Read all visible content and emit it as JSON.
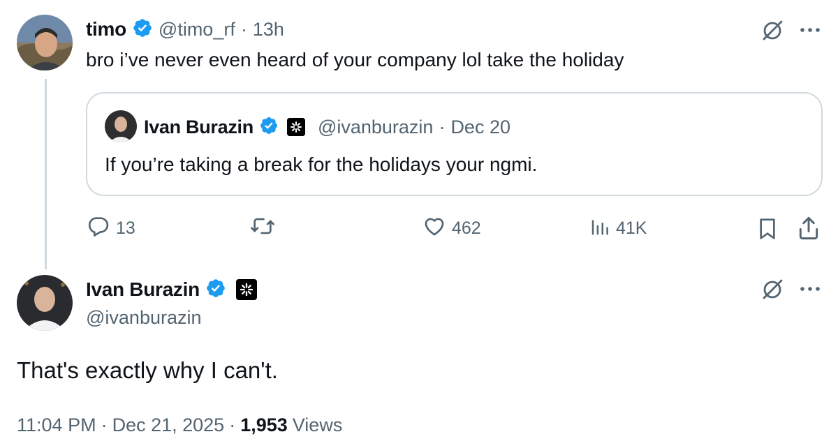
{
  "reply_parent": {
    "display_name": "timo",
    "handle": "@timo_rf",
    "separator": "·",
    "time": "13h",
    "text": "bro i’ve never even heard of your company lol take the holiday",
    "quoted": {
      "display_name": "Ivan Burazin",
      "handle": "@ivanburazin",
      "separator": "·",
      "date": "Dec 20",
      "text": "If you’re taking a break for the holidays your ngmi."
    },
    "actions": {
      "replies": "13",
      "likes": "462",
      "views": "41K"
    }
  },
  "main_tweet": {
    "display_name": "Ivan Burazin",
    "handle": "@ivanburazin",
    "text": "That's exactly why I can't.",
    "time": "11:04 PM",
    "sep1": "·",
    "date": "Dec 21, 2025",
    "sep2": "·",
    "views_count": "1,953",
    "views_label": "Views"
  },
  "icons": [
    "grok-icon",
    "more-icon",
    "verified-badge-icon",
    "org-badge-icon",
    "reply-icon",
    "retweet-icon",
    "like-icon",
    "views-icon",
    "bookmark-icon",
    "share-icon"
  ],
  "colors": {
    "text": "#0f1419",
    "muted": "#536471",
    "verified": "#1d9bf0",
    "border": "#cfd9de"
  }
}
